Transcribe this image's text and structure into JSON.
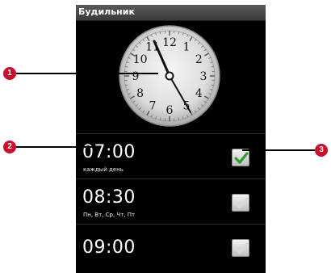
{
  "app": {
    "title": "Будильник"
  },
  "clock": {
    "numerals": [
      "12",
      "1",
      "2",
      "3",
      "4",
      "5",
      "6",
      "7",
      "8",
      "9",
      "10",
      "11"
    ],
    "time": "10:25"
  },
  "alarms": [
    {
      "time": "07:00",
      "days": "каждый день",
      "enabled": true
    },
    {
      "time": "08:30",
      "days": "Пн, Вт, Ср, Чт, Пт",
      "enabled": false
    },
    {
      "time": "09:00",
      "days": "",
      "enabled": false
    }
  ],
  "callouts": [
    "1",
    "2",
    "3"
  ],
  "colors": {
    "callout": "#c8102e",
    "check": "#2a9d2a",
    "background": "#000000"
  }
}
